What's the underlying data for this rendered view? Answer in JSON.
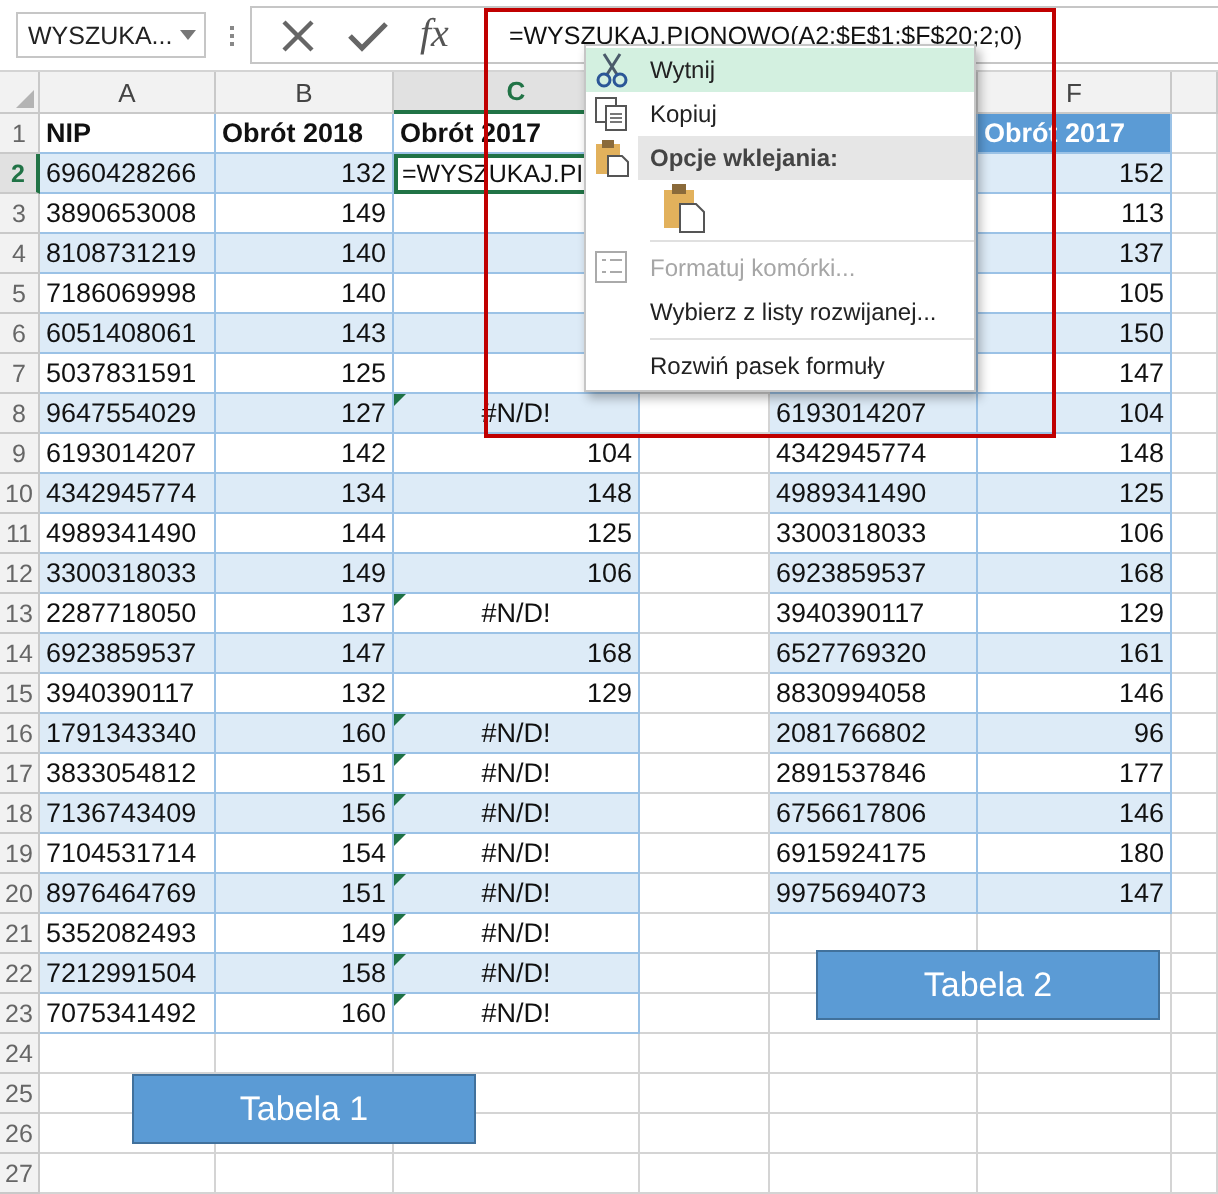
{
  "formula_bar": {
    "name_box": "WYSZUKA...",
    "function_button": "fx",
    "formula": "=WYSZUKAJ.PIONOWO(A2;$E$1:$F$20;2;0)"
  },
  "column_headers": [
    {
      "label": "A",
      "selected": false
    },
    {
      "label": "B",
      "selected": false
    },
    {
      "label": "C",
      "selected": true
    },
    {
      "label": "F",
      "selected": false
    }
  ],
  "row_numbers": [
    {
      "label": "1",
      "selected": false
    },
    {
      "label": "2",
      "selected": true
    },
    {
      "label": "3",
      "selected": false
    },
    {
      "label": "4",
      "selected": false
    },
    {
      "label": "5",
      "selected": false
    },
    {
      "label": "6",
      "selected": false
    },
    {
      "label": "7",
      "selected": false
    },
    {
      "label": "8",
      "selected": false
    },
    {
      "label": "9",
      "selected": false
    },
    {
      "label": "10",
      "selected": false
    },
    {
      "label": "11",
      "selected": false
    },
    {
      "label": "12",
      "selected": false
    },
    {
      "label": "13",
      "selected": false
    },
    {
      "label": "14",
      "selected": false
    },
    {
      "label": "15",
      "selected": false
    },
    {
      "label": "16",
      "selected": false
    },
    {
      "label": "17",
      "selected": false
    },
    {
      "label": "18",
      "selected": false
    },
    {
      "label": "19",
      "selected": false
    },
    {
      "label": "20",
      "selected": false
    },
    {
      "label": "21",
      "selected": false
    },
    {
      "label": "22",
      "selected": false
    },
    {
      "label": "23",
      "selected": false
    },
    {
      "label": "24",
      "selected": false
    },
    {
      "label": "25",
      "selected": false
    },
    {
      "label": "26",
      "selected": false
    },
    {
      "label": "27",
      "selected": false
    }
  ],
  "table1": {
    "columns": [
      "NIP",
      "Obrót 2018",
      "Obrót 2017"
    ],
    "rows": [
      {
        "nip": "6960428266",
        "obrot_2018": "132",
        "obrot_2017": "=WYSZUKAJ.PI",
        "editing": true,
        "error_flag": false
      },
      {
        "nip": "3890653008",
        "obrot_2018": "149",
        "editing": false,
        "error_flag": false
      },
      {
        "nip": "8108731219",
        "obrot_2018": "140",
        "editing": false,
        "error_flag": false
      },
      {
        "nip": "7186069998",
        "obrot_2018": "140",
        "editing": false,
        "error_flag": false
      },
      {
        "nip": "6051408061",
        "obrot_2018": "143",
        "editing": false,
        "error_flag": false
      },
      {
        "nip": "5037831591",
        "obrot_2018": "125",
        "editing": false,
        "error_flag": false
      },
      {
        "nip": "9647554029",
        "obrot_2018": "127",
        "obrot_2017": "#N/D!",
        "editing": false,
        "error_flag": true
      },
      {
        "nip": "6193014207",
        "obrot_2018": "142",
        "obrot_2017": "104",
        "editing": false,
        "error_flag": false
      },
      {
        "nip": "4342945774",
        "obrot_2018": "134",
        "obrot_2017": "148",
        "editing": false,
        "error_flag": false
      },
      {
        "nip": "4989341490",
        "obrot_2018": "144",
        "obrot_2017": "125",
        "editing": false,
        "error_flag": false
      },
      {
        "nip": "3300318033",
        "obrot_2018": "149",
        "obrot_2017": "106",
        "editing": false,
        "error_flag": false
      },
      {
        "nip": "2287718050",
        "obrot_2018": "137",
        "obrot_2017": "#N/D!",
        "editing": false,
        "error_flag": true
      },
      {
        "nip": "6923859537",
        "obrot_2018": "147",
        "obrot_2017": "168",
        "editing": false,
        "error_flag": false
      },
      {
        "nip": "3940390117",
        "obrot_2018": "132",
        "obrot_2017": "129",
        "editing": false,
        "error_flag": false
      },
      {
        "nip": "1791343340",
        "obrot_2018": "160",
        "obrot_2017": "#N/D!",
        "editing": false,
        "error_flag": true
      },
      {
        "nip": "3833054812",
        "obrot_2018": "151",
        "obrot_2017": "#N/D!",
        "editing": false,
        "error_flag": true
      },
      {
        "nip": "7136743409",
        "obrot_2018": "156",
        "obrot_2017": "#N/D!",
        "editing": false,
        "error_flag": true
      },
      {
        "nip": "7104531714",
        "obrot_2018": "154",
        "obrot_2017": "#N/D!",
        "editing": false,
        "error_flag": true
      },
      {
        "nip": "8976464769",
        "obrot_2018": "151",
        "obrot_2017": "#N/D!",
        "editing": false,
        "error_flag": true
      },
      {
        "nip": "5352082493",
        "obrot_2018": "149",
        "obrot_2017": "#N/D!",
        "editing": false,
        "error_flag": true
      },
      {
        "nip": "7212991504",
        "obrot_2018": "158",
        "obrot_2017": "#N/D!",
        "editing": false,
        "error_flag": true
      },
      {
        "nip": "7075341492",
        "obrot_2018": "160",
        "obrot_2017": "#N/D!",
        "editing": false,
        "error_flag": true
      }
    ]
  },
  "table2": {
    "header": "Obrót 2017",
    "rows": [
      {
        "obrot_2017": "152"
      },
      {
        "obrot_2017": "113"
      },
      {
        "obrot_2017": "137"
      },
      {
        "obrot_2017": "105"
      },
      {
        "obrot_2017": "150"
      },
      {
        "obrot_2017": "147"
      },
      {
        "nip": "6193014207",
        "obrot_2017": "104"
      },
      {
        "nip": "4342945774",
        "obrot_2017": "148"
      },
      {
        "nip": "4989341490",
        "obrot_2017": "125"
      },
      {
        "nip": "3300318033",
        "obrot_2017": "106"
      },
      {
        "nip": "6923859537",
        "obrot_2017": "168"
      },
      {
        "nip": "3940390117",
        "obrot_2017": "129"
      },
      {
        "nip": "6527769320",
        "obrot_2017": "161"
      },
      {
        "nip": "8830994058",
        "obrot_2017": "146"
      },
      {
        "nip": "2081766802",
        "obrot_2017": "96"
      },
      {
        "nip": "2891537846",
        "obrot_2017": "177"
      },
      {
        "nip": "6756617806",
        "obrot_2017": "146"
      },
      {
        "nip": "6915924175",
        "obrot_2017": "180"
      },
      {
        "nip": "9975694073",
        "obrot_2017": "147"
      }
    ]
  },
  "context_menu": [
    {
      "kind": "item",
      "label": "Wytnij",
      "highlighted": true,
      "disabled": false
    },
    {
      "kind": "item",
      "label": "Kopiuj",
      "highlighted": false,
      "disabled": false
    },
    {
      "kind": "header",
      "label": "Opcje wklejania:"
    },
    {
      "kind": "paste-options"
    },
    {
      "kind": "separator"
    },
    {
      "kind": "item",
      "label": "Formatuj komórki...",
      "highlighted": false,
      "disabled": true
    },
    {
      "kind": "item",
      "label": "Wybierz z listy rozwijanej...",
      "highlighted": false,
      "disabled": false
    },
    {
      "kind": "separator"
    },
    {
      "kind": "item",
      "label": "Rozwiń pasek formuły",
      "highlighted": false,
      "disabled": false
    }
  ],
  "text_boxes": [
    {
      "label": "Tabela 2"
    },
    {
      "label": "Tabela 1"
    }
  ]
}
